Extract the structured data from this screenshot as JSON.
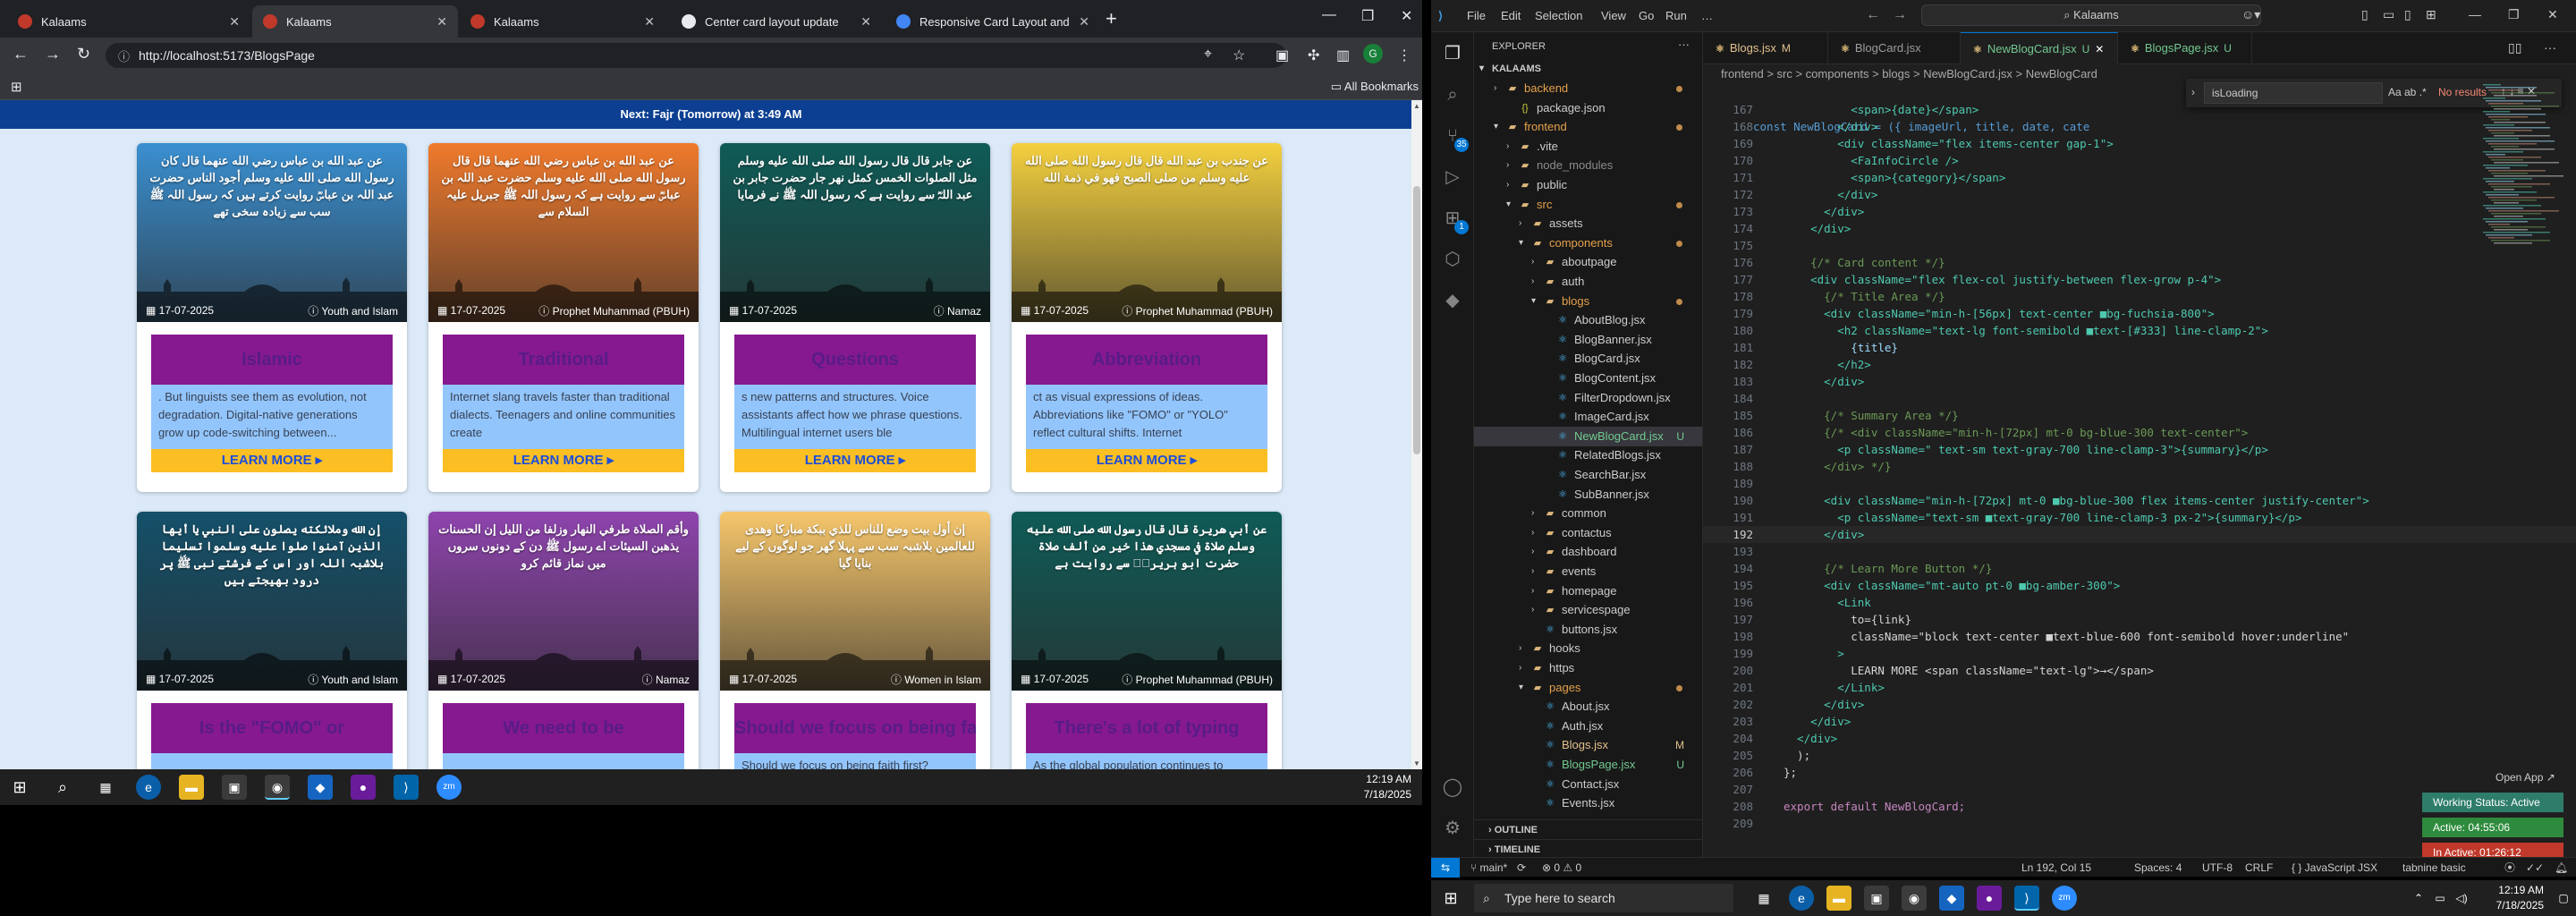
{
  "chrome": {
    "tabs": [
      {
        "title": "Kalaams",
        "color": "#c0392b"
      },
      {
        "title": "Kalaams",
        "color": "#c0392b",
        "active": true
      },
      {
        "title": "Kalaams",
        "color": "#c0392b"
      },
      {
        "title": "Center card layout update",
        "color": "#e8eaed"
      },
      {
        "title": "Responsive Card Layout and Al",
        "color": "#4285f4"
      }
    ],
    "new_tab": "+",
    "url": "http://localhost:5173/BlogsPage",
    "url_icon": "ⓘ",
    "all_bookmarks": "All Bookmarks",
    "profile_initial": "G"
  },
  "page": {
    "prayer_banner": "Next: Fajr (Tomorrow) at 3:49 AM",
    "cards": [
      {
        "urdu": "عن عبد الله بن عباس رضي الله عنهما قال كان رسول الله صلى الله عليه وسلم أجود الناس حضرت عبد اللہ بن عباسؓ روایت کرتے ہیں کہ رسول اللہ ﷺ سب سے زیادہ سخی تھے",
        "date": "17-07-2025",
        "category": "Youth and Islam",
        "title": "Islamic",
        "summary": ". But linguists see them as evolution, not degradation. Digital-native generations grow up code-switching between...",
        "learn": "LEARN MORE",
        "theme": "#3a8fd0"
      },
      {
        "urdu": "عن عبد الله بن عباس رضي الله عنهما قال قال رسول الله صلى الله عليه وسلم حضرت عبد اللہ بن عباسؓ سے روایت ہے کہ رسول اللہ ﷺ جبریل علیہ السلام سے",
        "date": "17-07-2025",
        "category": "Prophet Muhammad (PBUH)",
        "title": "Traditional",
        "summary": "Internet slang travels faster than traditional dialects. Teenagers and online communities create",
        "learn": "LEARN MORE",
        "theme": "#f07a2c"
      },
      {
        "urdu": "عن جابر قال قال رسول الله صلى الله عليه وسلم مثل الصلوات الخمس كمثل نهر جار حضرت جابر بن عبد اللہؓ سے روایت ہے کہ رسول اللہ ﷺ نے فرمایا",
        "date": "17-07-2025",
        "category": "Namaz",
        "title": "Questions",
        "summary": "s new patterns and structures. Voice assistants affect how we phrase questions. Multilingual internet users ble",
        "learn": "LEARN MORE",
        "theme": "#0f5b57"
      },
      {
        "urdu": "عن جندب بن عبد الله قال قال رسول الله صلى الله عليه وسلم من صلى الصبح فهو في ذمة الله",
        "date": "17-07-2025",
        "category": "Prophet Muhammad (PBUH)",
        "title": "Abbreviation",
        "summary": "ct as visual expressions of ideas. Abbreviations like \"FOMO\" or \"YOLO\" reflect cultural shifts. Internet",
        "learn": "LEARN MORE",
        "theme": "#f4d03f"
      },
      {
        "urdu": "إن الله وملائكته يصلون على النبي يا أيها الذين آمنوا صلوا عليه وسلموا تسليما بلاشبہ اللہ اور اس کے فرشتے نبی ﷺ پر درود بھیجتے ہیں",
        "date": "17-07-2025",
        "category": "Youth and Islam",
        "title": "Is the \"FOMO\" or",
        "summary": "",
        "learn": "",
        "theme": "#14506a"
      },
      {
        "urdu": "وأقم الصلاة طرفي النهار وزلفا من الليل إن الحسنات يذهبن السيئات اے رسول ﷺ دن کے دونوں سروں میں نماز قائم کرو",
        "date": "17-07-2025",
        "category": "Namaz",
        "title": "We need to be",
        "summary": "",
        "learn": "",
        "theme": "#8e44ad"
      },
      {
        "urdu": "إن أول بيت وضع للناس للذي ببكة مباركا وهدى للعالمين بلاشبہ سب سے پہلا گھر جو لوگوں کے لیے بنایا گیا",
        "date": "17-07-2025",
        "category": "Women in Islam",
        "title": "Should we focus on being faith",
        "summary": "Should we focus on being faith first?",
        "learn": "",
        "theme": "#f6c66b"
      },
      {
        "urdu": "عن أبي هريرة قال قال رسول الله صلى الله عليه وسلم صلاة في مسجدي هذا خير من ألف صلاة حضرت ابو ہریرہؓ سے روایت ہے",
        "date": "17-07-2025",
        "category": "Prophet Muhammad (PBUH)",
        "title": "There's a lot of typing",
        "summary": "As the global population continues to",
        "learn": "",
        "theme": "#0f5b57"
      }
    ]
  },
  "left_taskbar": {
    "time": "12:19 AM",
    "date": "7/18/2025"
  },
  "vscode": {
    "menu": [
      "File",
      "Edit",
      "Selection",
      "View",
      "Go",
      "Run",
      "…"
    ],
    "command_center": "Kalaams",
    "explorer_title": "EXPLORER",
    "workspace": "KALAAMS",
    "tree": [
      {
        "name": "backend",
        "depth": 1,
        "folder": true,
        "open": false,
        "dot": true,
        "color": "#e5a14b"
      },
      {
        "name": "package.json",
        "depth": 2,
        "folder": false,
        "color": "#cccccc"
      },
      {
        "name": "frontend",
        "depth": 1,
        "folder": true,
        "open": true,
        "dot": true,
        "color": "#e5a14b"
      },
      {
        "name": ".vite",
        "depth": 2,
        "folder": true,
        "open": false,
        "color": "#cccccc"
      },
      {
        "name": "node_modules",
        "depth": 2,
        "folder": true,
        "open": false,
        "color": "#8b8b8b"
      },
      {
        "name": "public",
        "depth": 2,
        "folder": true,
        "open": false,
        "color": "#cccccc"
      },
      {
        "name": "src",
        "depth": 2,
        "folder": true,
        "open": true,
        "dot": true,
        "color": "#e5a14b"
      },
      {
        "name": "assets",
        "depth": 3,
        "folder": true,
        "open": false,
        "color": "#cccccc"
      },
      {
        "name": "components",
        "depth": 3,
        "folder": true,
        "open": true,
        "dot": true,
        "color": "#e5a14b"
      },
      {
        "name": "aboutpage",
        "depth": 4,
        "folder": true,
        "open": false,
        "color": "#cccccc"
      },
      {
        "name": "auth",
        "depth": 4,
        "folder": true,
        "open": false,
        "color": "#cccccc"
      },
      {
        "name": "blogs",
        "depth": 4,
        "folder": true,
        "open": true,
        "dot": true,
        "color": "#e5a14b"
      },
      {
        "name": "AboutBlog.jsx",
        "depth": 5,
        "folder": false,
        "color": "#cccccc"
      },
      {
        "name": "BlogBanner.jsx",
        "depth": 5,
        "folder": false,
        "color": "#cccccc"
      },
      {
        "name": "BlogCard.jsx",
        "depth": 5,
        "folder": false,
        "color": "#cccccc"
      },
      {
        "name": "BlogContent.jsx",
        "depth": 5,
        "folder": false,
        "color": "#cccccc"
      },
      {
        "name": "FilterDropdown.jsx",
        "depth": 5,
        "folder": false,
        "color": "#cccccc"
      },
      {
        "name": "ImageCard.jsx",
        "depth": 5,
        "folder": false,
        "color": "#cccccc"
      },
      {
        "name": "NewBlogCard.jsx",
        "depth": 5,
        "folder": false,
        "badge": "U",
        "selected": true,
        "color": "#73c991"
      },
      {
        "name": "RelatedBlogs.jsx",
        "depth": 5,
        "folder": false,
        "color": "#cccccc"
      },
      {
        "name": "SearchBar.jsx",
        "depth": 5,
        "folder": false,
        "color": "#cccccc"
      },
      {
        "name": "SubBanner.jsx",
        "depth": 5,
        "folder": false,
        "color": "#cccccc"
      },
      {
        "name": "common",
        "depth": 4,
        "folder": true,
        "open": false,
        "color": "#cccccc"
      },
      {
        "name": "contactus",
        "depth": 4,
        "folder": true,
        "open": false,
        "color": "#cccccc"
      },
      {
        "name": "dashboard",
        "depth": 4,
        "folder": true,
        "open": false,
        "color": "#cccccc"
      },
      {
        "name": "events",
        "depth": 4,
        "folder": true,
        "open": false,
        "color": "#cccccc"
      },
      {
        "name": "homepage",
        "depth": 4,
        "folder": true,
        "open": false,
        "color": "#cccccc"
      },
      {
        "name": "servicespage",
        "depth": 4,
        "folder": true,
        "open": false,
        "color": "#cccccc"
      },
      {
        "name": "buttons.jsx",
        "depth": 4,
        "folder": false,
        "color": "#cccccc"
      },
      {
        "name": "hooks",
        "depth": 3,
        "folder": true,
        "open": false,
        "color": "#cccccc"
      },
      {
        "name": "https",
        "depth": 3,
        "folder": true,
        "open": false,
        "color": "#cccccc"
      },
      {
        "name": "pages",
        "depth": 3,
        "folder": true,
        "open": true,
        "dot": true,
        "color": "#e5a14b"
      },
      {
        "name": "About.jsx",
        "depth": 4,
        "folder": false,
        "color": "#cccccc"
      },
      {
        "name": "Auth.jsx",
        "depth": 4,
        "folder": false,
        "color": "#cccccc"
      },
      {
        "name": "Blogs.jsx",
        "depth": 4,
        "folder": false,
        "badge": "M",
        "color": "#e2c08d"
      },
      {
        "name": "BlogsPage.jsx",
        "depth": 4,
        "folder": false,
        "badge": "U",
        "color": "#73c991"
      },
      {
        "name": "Contact.jsx",
        "depth": 4,
        "folder": false,
        "color": "#cccccc"
      },
      {
        "name": "Events.jsx",
        "depth": 4,
        "folder": false,
        "color": "#cccccc"
      }
    ],
    "outline": "OUTLINE",
    "timeline": "TIMELINE",
    "editor_tabs": [
      {
        "name": "Blogs.jsx",
        "status": "M",
        "color": "#e2c08d"
      },
      {
        "name": "BlogCard.jsx",
        "status": "",
        "color": "#cccccc"
      },
      {
        "name": "NewBlogCard.jsx",
        "status": "U",
        "color": "#73c991",
        "active": true
      },
      {
        "name": "BlogsPage.jsx",
        "status": "U",
        "color": "#73c991"
      }
    ],
    "breadcrumbs": "frontend > src > components > blogs > NewBlogCard.jsx > NewBlogCard",
    "find": {
      "query": "isLoading",
      "options": "Aa ab .*",
      "result": "No results",
      "arrows": "↑ ↓ ≡ ✕"
    },
    "first_line": "const NewBlogCard = ({ imageUrl, title, date, cate",
    "code": [
      {
        "n": "167",
        "t": "          <span>{date}</span>"
      },
      {
        "n": "168",
        "t": "        </div>"
      },
      {
        "n": "169",
        "t": "        <div className=\"flex items-center gap-1\">"
      },
      {
        "n": "170",
        "t": "          <FaInfoCircle />"
      },
      {
        "n": "171",
        "t": "          <span>{category}</span>"
      },
      {
        "n": "172",
        "t": "        </div>"
      },
      {
        "n": "173",
        "t": "      </div>"
      },
      {
        "n": "174",
        "t": "    </div>"
      },
      {
        "n": "175",
        "t": ""
      },
      {
        "n": "176",
        "t": "    {/* Card content */}"
      },
      {
        "n": "177",
        "t": "    <div className=\"flex flex-col justify-between flex-grow p-4\">"
      },
      {
        "n": "178",
        "t": "      {/* Title Area */}"
      },
      {
        "n": "179",
        "t": "      <div className=\"min-h-[56px] text-center ■bg-fuchsia-800\">"
      },
      {
        "n": "180",
        "t": "        <h2 className=\"text-lg font-semibold ■text-[#333] line-clamp-2\">"
      },
      {
        "n": "181",
        "t": "          {title}"
      },
      {
        "n": "182",
        "t": "        </h2>"
      },
      {
        "n": "183",
        "t": "      </div>"
      },
      {
        "n": "184",
        "t": ""
      },
      {
        "n": "185",
        "t": "      {/* Summary Area */}"
      },
      {
        "n": "186",
        "t": "      {/* <div className=\"min-h-[72px] mt-0 bg-blue-300 text-center\">"
      },
      {
        "n": "187",
        "t": "        <p className=\" text-sm text-gray-700 line-clamp-3\">{summary}</p>"
      },
      {
        "n": "188",
        "t": "      </div> */}"
      },
      {
        "n": "189",
        "t": ""
      },
      {
        "n": "190",
        "t": "      <div className=\"min-h-[72px] mt-0 ■bg-blue-300 flex items-center justify-center\">"
      },
      {
        "n": "191",
        "t": "        <p className=\"text-sm ■text-gray-700 line-clamp-3 px-2\">{summary}</p>"
      },
      {
        "n": "192",
        "t": "      </div>"
      },
      {
        "n": "193",
        "t": ""
      },
      {
        "n": "194",
        "t": "      {/* Learn More Button */}"
      },
      {
        "n": "195",
        "t": "      <div className=\"mt-auto pt-0 ■bg-amber-300\">"
      },
      {
        "n": "196",
        "t": "        <Link"
      },
      {
        "n": "197",
        "t": "          to={link}"
      },
      {
        "n": "198",
        "t": "          className=\"block text-center ■text-blue-600 font-semibold hover:underline\""
      },
      {
        "n": "199",
        "t": "        >"
      },
      {
        "n": "200",
        "t": "          LEARN MORE <span className=\"text-lg\">→</span>"
      },
      {
        "n": "201",
        "t": "        </Link>"
      },
      {
        "n": "202",
        "t": "      </div>"
      },
      {
        "n": "203",
        "t": "    </div>"
      },
      {
        "n": "204",
        "t": "  </div>"
      },
      {
        "n": "205",
        "t": "  );"
      },
      {
        "n": "206",
        "t": "};"
      },
      {
        "n": "207",
        "t": ""
      },
      {
        "n": "208",
        "t": "export default NewBlogCard;"
      },
      {
        "n": "209",
        "t": ""
      }
    ],
    "current_line": "192",
    "status": {
      "branch": "main*",
      "problems": "⊗ 0 ⚠ 0",
      "position": "Ln 192, Col 15",
      "spaces": "Spaces: 4",
      "encoding": "UTF-8",
      "eol": "CRLF",
      "language": "{ } JavaScript JSX",
      "extension": "tabnine basic"
    },
    "open_app": "Open App ↗",
    "working_status": [
      {
        "text": "Working Status: Active",
        "color": "#2e7d6a"
      },
      {
        "text": "Active: 04:55:06",
        "color": "#2e8b3d"
      },
      {
        "text": "In Active: 01:26:12",
        "color": "#c0392b"
      }
    ]
  },
  "right_taskbar": {
    "search_placeholder": "Type here to search",
    "time": "12:19 AM",
    "date": "7/18/2025"
  }
}
